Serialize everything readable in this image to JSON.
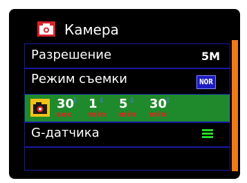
{
  "header": {
    "title": "Камера",
    "icon": "camera-icon"
  },
  "menu": {
    "items": [
      {
        "label": "Разрешение",
        "value": "5M"
      },
      {
        "label": "Режим съемки",
        "value": "NOR",
        "value_icon": "nor-badge-icon"
      },
      {
        "icon": "burst-camera-icon",
        "options": [
          {
            "number": "30",
            "unit": "sec"
          },
          {
            "number": "1",
            "unit": "min"
          },
          {
            "number": "5",
            "unit": "min"
          },
          {
            "number": "30",
            "unit": "min"
          }
        ],
        "selected": true
      },
      {
        "label": "G-датчика",
        "value_icon": "g-sensor-level-icon"
      },
      {
        "label": ""
      }
    ]
  },
  "colors": {
    "background": "#000000",
    "row_border": "#1a1aa8",
    "selected_row": "#1f8a2b",
    "scrollbar": "#f07a16",
    "unit_text": "#e8201a",
    "nor_badge": "#1c1cc2",
    "g_sensor_bars": "#22dd22"
  }
}
